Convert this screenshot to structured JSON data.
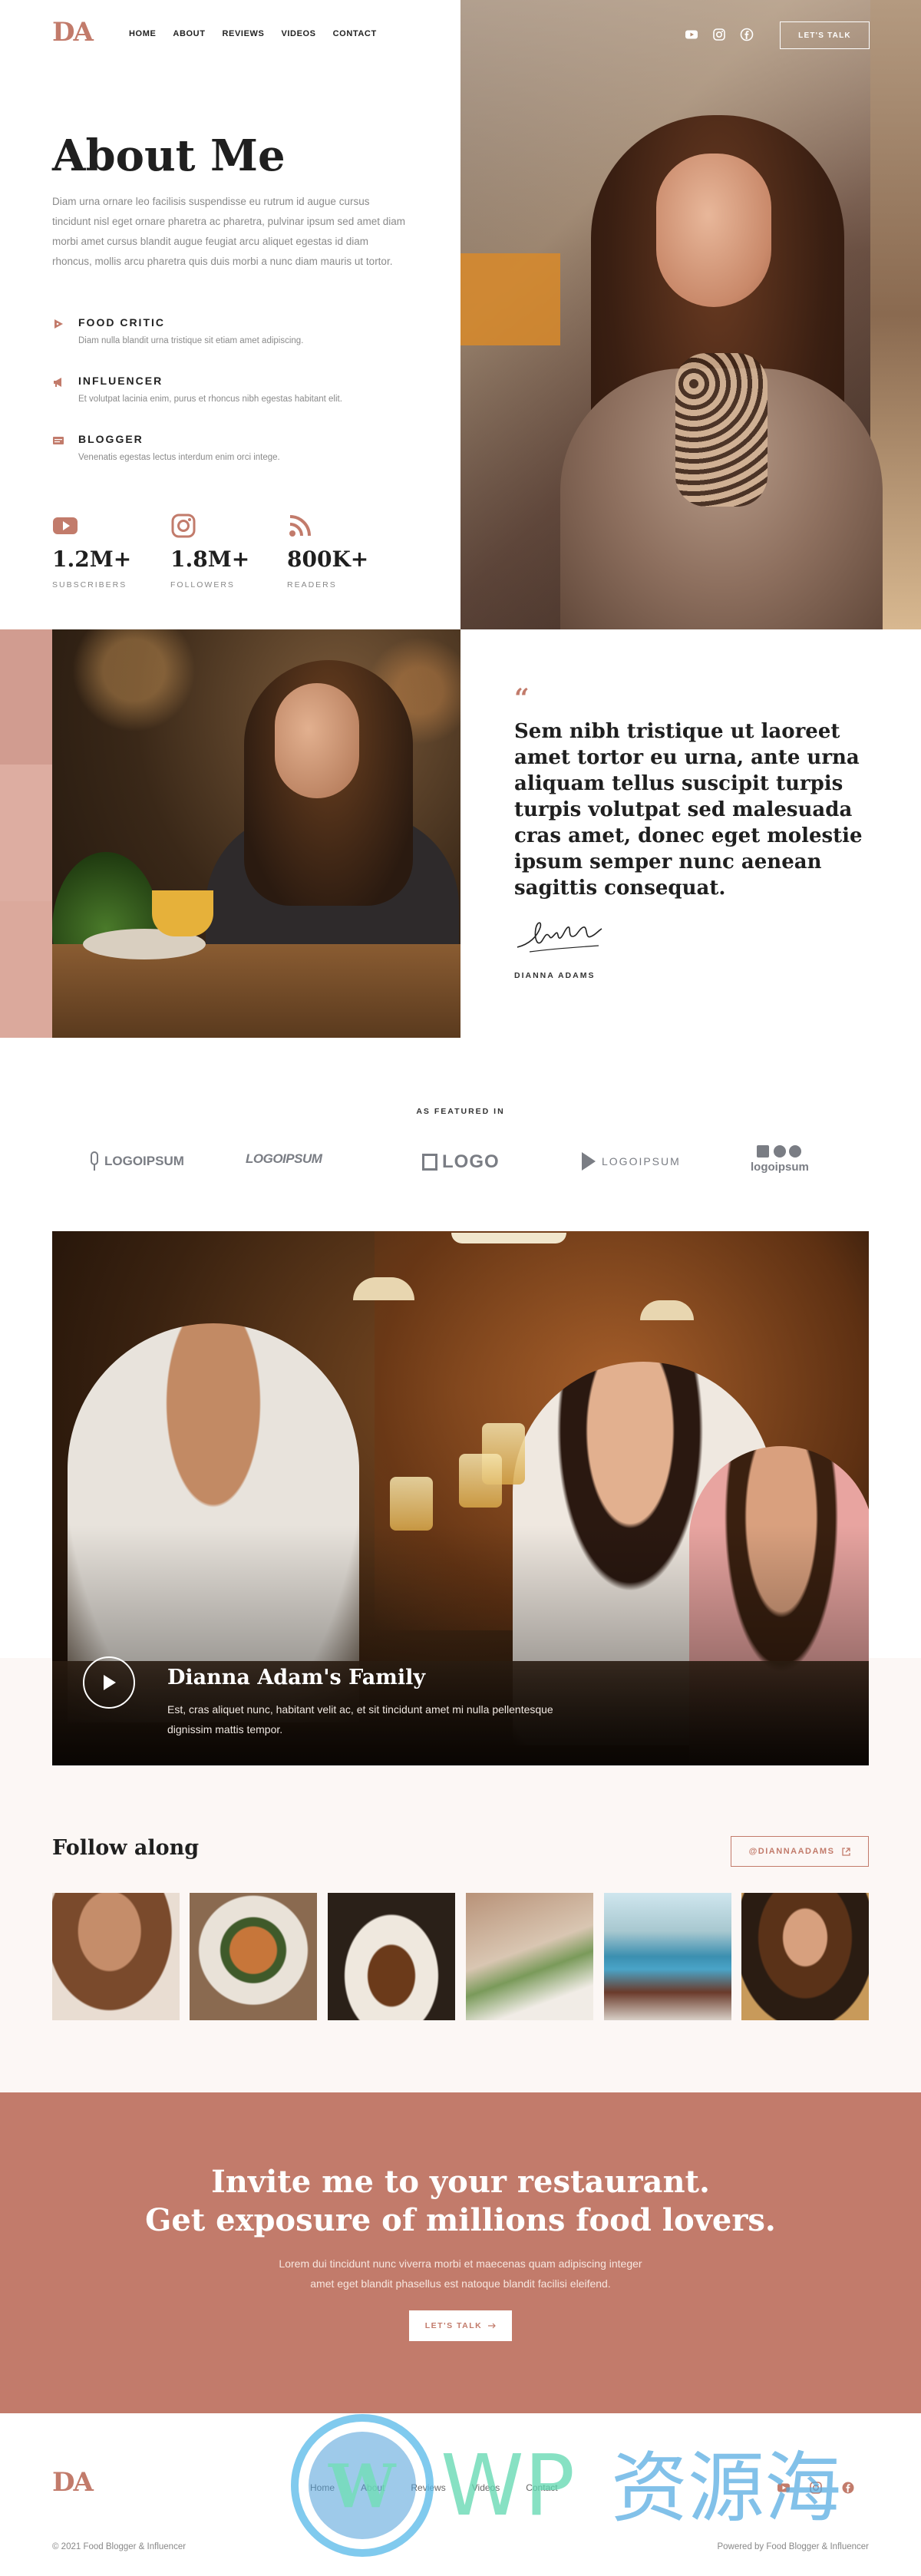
{
  "brand": {
    "logo": "DA",
    "accent": "#c27b6b"
  },
  "nav": [
    "HOME",
    "ABOUT",
    "REVIEWS",
    "VIDEOS",
    "CONTACT"
  ],
  "header": {
    "cta_label": "LET'S TALK",
    "social_icons": [
      "youtube-icon",
      "instagram-icon",
      "facebook-icon"
    ]
  },
  "about": {
    "title": "About Me",
    "text": "Diam urna ornare leo facilisis suspendisse eu rutrum id augue cursus tincidunt nisl eget ornare pharetra ac pharetra, pulvinar ipsum sed amet diam morbi amet cursus blandit augue feugiat arcu aliquet egestas id diam rhoncus, mollis arcu pharetra quis duis morbi a nunc diam mauris ut tortor.",
    "roles": [
      {
        "title": "FOOD CRITIC",
        "desc": "Diam nulla blandit urna tristique sit etiam amet adipiscing.",
        "icon": "food-icon"
      },
      {
        "title": "INFLUENCER",
        "desc": "Et volutpat lacinia enim, purus et rhoncus nibh egestas habitant elit.",
        "icon": "megaphone-icon"
      },
      {
        "title": "BLOGGER",
        "desc": "Venenatis egestas lectus interdum enim orci intege.",
        "icon": "blog-icon"
      }
    ],
    "stats": [
      {
        "value": "1.2M+",
        "label": "SUBSCRIBERS",
        "icon": "youtube-icon"
      },
      {
        "value": "1.8M+",
        "label": "FOLLOWERS",
        "icon": "instagram-icon"
      },
      {
        "value": "800K+",
        "label": "READERS",
        "icon": "rss-icon"
      }
    ]
  },
  "quote": {
    "mark": "“",
    "text": "Sem nibh tristique ut laoreet amet tortor eu urna, ante urna aliquam tellus suscipit turpis turpis volutpat sed malesuada cras amet, donec eget molestie ipsum semper nunc aenean sagittis consequat.",
    "author": "DIANNA ADAMS"
  },
  "featured": {
    "title": "AS FEATURED IN",
    "logos": [
      "LOGOIPSUM",
      "LOGOIPSUM",
      "LOGO",
      "LOGOIPSUM",
      "logoipsum"
    ]
  },
  "video": {
    "title": "Dianna Adam's Family",
    "desc": "Est, cras aliquet nunc, habitant velit ac, et sit tincidunt amet mi nulla pellentesque dignissim mattis tempor."
  },
  "follow": {
    "title": "Follow along",
    "handle": "@DIANNAADAMS"
  },
  "cta": {
    "title_line1": "Invite me to your restaurant.",
    "title_line2": "Get exposure of millions food lovers.",
    "desc_line1": "Lorem dui tincidunt nunc viverra morbi et maecenas quam adipiscing integer",
    "desc_line2": "amet eget blandit phasellus est natoque blandit facilisi eleifend.",
    "button": "LET'S TALK"
  },
  "footer": {
    "nav": [
      "Home",
      "About",
      "Reviews",
      "Videos",
      "Contact"
    ],
    "copyright": "© 2021 Food Blogger & Influencer",
    "powered": "Powered by Food Blogger & Influencer"
  },
  "watermark": {
    "letters": "WP",
    "chinese": "资源海"
  }
}
